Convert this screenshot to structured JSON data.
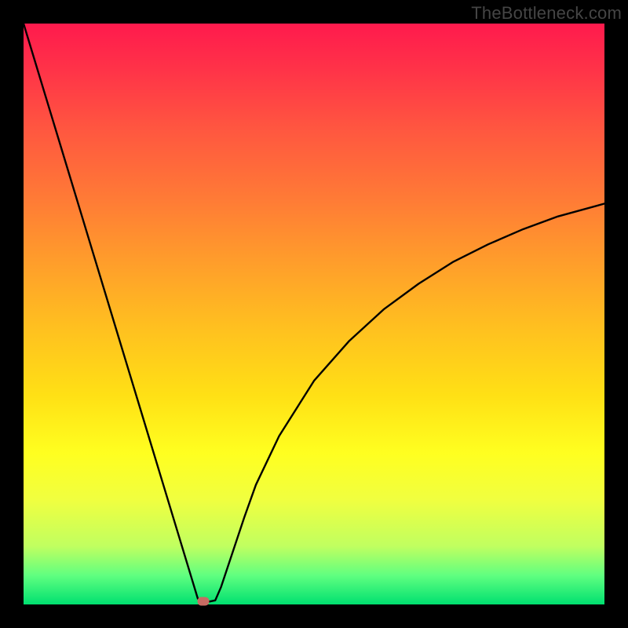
{
  "watermark": "TheBottleneck.com",
  "chart_data": {
    "type": "line",
    "title": "",
    "xlabel": "",
    "ylabel": "",
    "xlim": [
      0,
      100
    ],
    "ylim": [
      0,
      100
    ],
    "grid": false,
    "legend": false,
    "curve": {
      "name": "bottleneck-curve",
      "x": [
        0,
        2,
        4,
        6,
        8,
        10,
        12,
        14,
        16,
        18,
        20,
        22,
        24,
        26,
        28,
        29,
        30,
        31,
        32,
        33,
        34,
        36,
        38,
        40,
        44,
        50,
        56,
        62,
        68,
        74,
        80,
        86,
        92,
        100
      ],
      "y": [
        100,
        93.4,
        86.8,
        80.2,
        73.6,
        67.0,
        60.4,
        53.8,
        47.2,
        40.6,
        34.0,
        27.4,
        20.8,
        14.2,
        7.6,
        4.3,
        1.0,
        0.7,
        0.5,
        0.7,
        3.0,
        9.0,
        15.0,
        20.6,
        29.0,
        38.5,
        45.3,
        50.8,
        55.2,
        59.0,
        62.0,
        64.6,
        66.8,
        69.0
      ]
    },
    "marker": {
      "x": 31,
      "y": 0.5,
      "color": "#c76b63"
    },
    "background": {
      "type": "vertical-gradient",
      "stops": [
        {
          "pos": 0.0,
          "color": "#ff1a4d"
        },
        {
          "pos": 0.3,
          "color": "#ff7a36"
        },
        {
          "pos": 0.64,
          "color": "#ffe015"
        },
        {
          "pos": 0.82,
          "color": "#f0ff40"
        },
        {
          "pos": 1.0,
          "color": "#00e070"
        }
      ]
    }
  }
}
